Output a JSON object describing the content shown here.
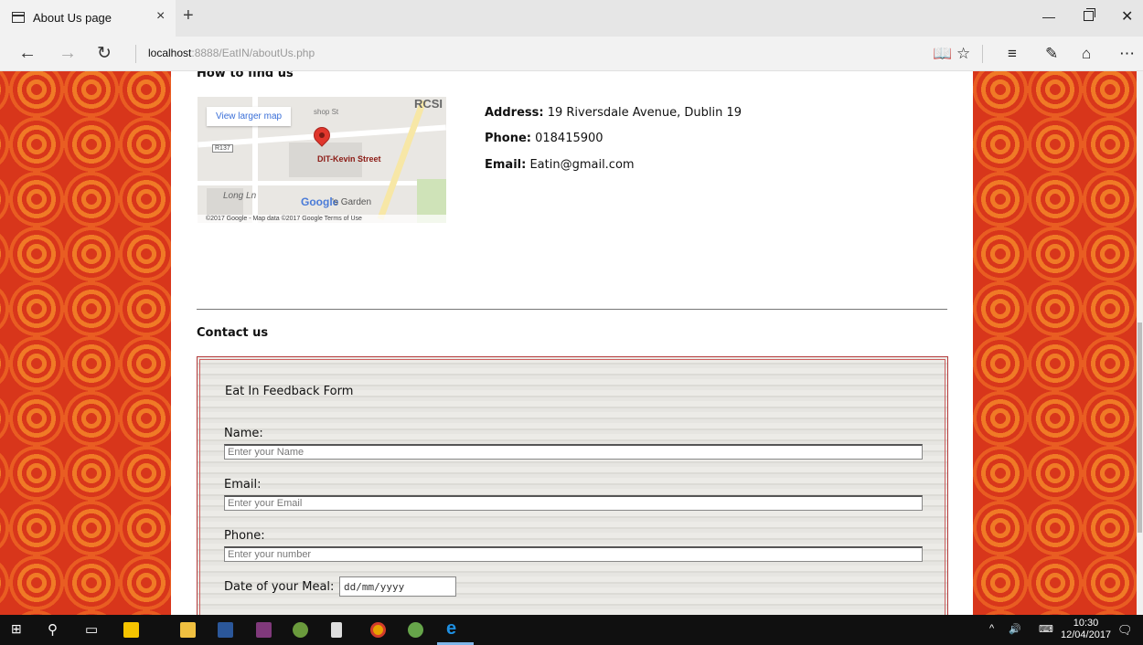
{
  "browser": {
    "tab_title": "About Us page",
    "tab_close": "×",
    "new_tab": "+",
    "url_host": "localhost",
    "url_rest": ":8888/EatIN/aboutUs.php"
  },
  "page": {
    "find_heading": "How to find us",
    "map": {
      "view_larger": "View larger map",
      "rcsi": "RCSI",
      "shop_st": "shop St",
      "r137": "R137",
      "long_ln": "Long Ln",
      "place": "DIT-Kevin Street",
      "google": "Google",
      "garden": "'s Garden",
      "footer": "©2017 Google - Map data ©2017 Google   Terms of Use"
    },
    "contact_info": {
      "address_label": "Address:",
      "address_value": " 19 Riversdale Avenue, Dublin 19",
      "phone_label": "Phone:",
      "phone_value": " 018415900",
      "email_label": "Email:",
      "email_value": " Eatin@gmail.com"
    },
    "contact_heading": "Contact us",
    "form": {
      "title": "Eat In Feedback Form",
      "name_label": "Name:",
      "name_placeholder": "Enter your Name",
      "email_label": "Email:",
      "email_placeholder": "Enter your Email",
      "phone_label": "Phone:",
      "phone_placeholder": "Enter your number",
      "date_label": "Date of your Meal:",
      "date_placeholder": "dd/mm/yyyy"
    }
  },
  "taskbar": {
    "time": "10:30",
    "date": "12/04/2017",
    "icons": [
      "windows-start-icon",
      "search-icon",
      "task-view-icon",
      "sticky-notes-icon",
      "file-explorer-icon",
      "word-icon",
      "onenote-icon",
      "android-studio-icon",
      "phone-icon",
      "chrome-icon",
      "atom-icon",
      "edge-icon"
    ]
  },
  "colors": {
    "pattern_red": "#d8361b",
    "pattern_orange": "#f07a26",
    "form_border": "#b53c3c"
  }
}
